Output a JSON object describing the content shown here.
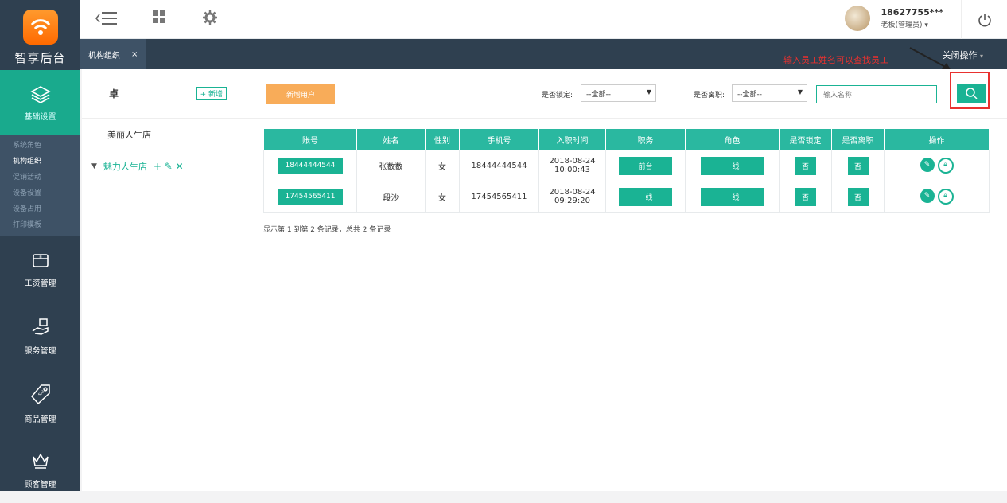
{
  "sidebar": {
    "logo_text": "智享后台",
    "active_menu": "基础设置",
    "submenu": [
      "系统角色",
      "机构组织",
      "促销活动",
      "设备设置",
      "设备占用",
      "打印模板"
    ],
    "menu": [
      {
        "label": "工资管理",
        "icon": "wallet-icon"
      },
      {
        "label": "服务管理",
        "icon": "hand-service-icon"
      },
      {
        "label": "商品管理",
        "icon": "sale-tag-icon"
      },
      {
        "label": "顾客管理",
        "icon": "crown-icon"
      }
    ]
  },
  "topbar": {
    "user_name": "18627755***",
    "user_role": "老板(管理员) ▾"
  },
  "tabs": {
    "active_tab": "机构组织",
    "close": "×",
    "close_ops": "关闭操作"
  },
  "annotation": {
    "hint": "输入员工姓名可以查找员工"
  },
  "tree": {
    "title": "卓",
    "add_label": "+ 新增",
    "nodes": [
      "美丽人生店",
      "魅力人生店"
    ],
    "node_ops": "+ ✎ ✕"
  },
  "toolbar": {
    "new_user": "新增用户",
    "locked_label": "是否锁定:",
    "locked_value": "--全部--",
    "left_label": "是否离职:",
    "left_value": "--全部--",
    "name_placeholder": "输入名称"
  },
  "table": {
    "headers": [
      "账号",
      "姓名",
      "性别",
      "手机号",
      "入职时间",
      "职务",
      "角色",
      "是否锁定",
      "是否离职",
      "操作"
    ],
    "rows": [
      {
        "account": "18444444544",
        "name": "张数数",
        "gender": "女",
        "phone": "18444444544",
        "date": "2018-08-24",
        "time": "10:00:43",
        "job": "前台",
        "role": "一线",
        "locked": "否",
        "left": "否"
      },
      {
        "account": "17454565411",
        "name": "段沙",
        "gender": "女",
        "phone": "17454565411",
        "date": "2018-08-24",
        "time": "09:29:20",
        "job": "一线",
        "role": "一线",
        "locked": "否",
        "left": "否"
      }
    ]
  },
  "summary": "显示第 1 到第 2 条记录，总共 2 条记录",
  "colors": {
    "accent": "#1ab394",
    "sidebar": "#2f4050",
    "orange": "#f8ac59",
    "annotation": "#e8312f"
  }
}
